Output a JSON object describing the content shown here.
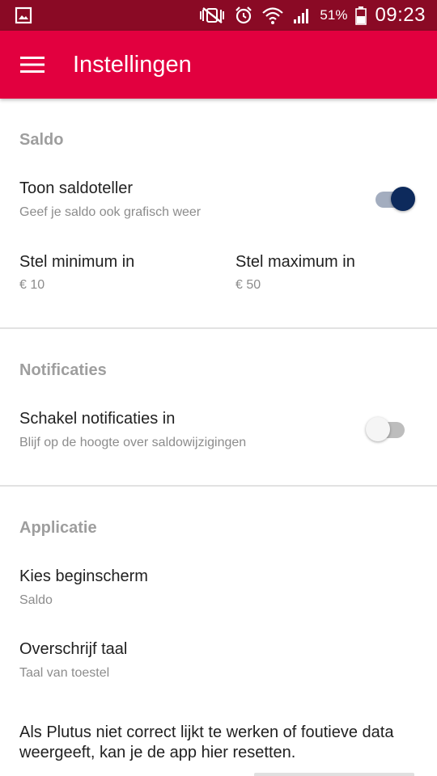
{
  "status_bar": {
    "battery_percent": "51%",
    "time": "09:23",
    "icons": [
      "gallery-icon",
      "mute-vibrate-icon",
      "alarm-icon",
      "wifi-icon",
      "signal-icon",
      "battery-icon"
    ]
  },
  "app_bar": {
    "title": "Instellingen",
    "menu_icon": "hamburger-menu-icon",
    "color": "#e2003f"
  },
  "sections": {
    "saldo": {
      "header": "Saldo",
      "show_counter": {
        "title": "Toon saldoteller",
        "summary": "Geef je saldo ook grafisch weer",
        "enabled": true
      },
      "minimum": {
        "title": "Stel minimum in",
        "value": "€ 10"
      },
      "maximum": {
        "title": "Stel maximum in",
        "value": "€ 50"
      }
    },
    "notificaties": {
      "header": "Notificaties",
      "enable_notifications": {
        "title": "Schakel notificaties in",
        "summary": "Blijf op de hoogte over saldowijzigingen",
        "enabled": false
      }
    },
    "applicatie": {
      "header": "Applicatie",
      "start_screen": {
        "title": "Kies beginscherm",
        "value": "Saldo"
      },
      "language": {
        "title": "Overschrijf taal",
        "value": "Taal van toestel"
      },
      "reset_text": "Als Plutus niet correct lijkt te werken of foutieve data weergeeft, kan je de app hier resetten."
    }
  },
  "colors": {
    "status_bar": "#8a0a25",
    "accent": "#e2003f",
    "switch_on": "#0d2a5c"
  }
}
